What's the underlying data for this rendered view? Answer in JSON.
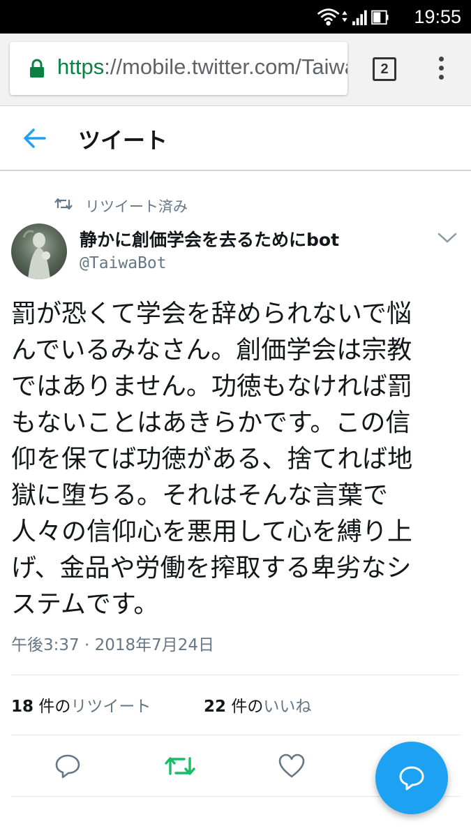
{
  "status_bar": {
    "time": "19:55"
  },
  "browser": {
    "url_scheme": "https",
    "url_rest": "://mobile.twitter.com/TaiwaBot",
    "tab_count": "2"
  },
  "header": {
    "title": "ツイート"
  },
  "tweet": {
    "retweeted_label": "リツイート済み",
    "author_name": "静かに創価学会を去るためにbot",
    "author_handle": "@TaiwaBot",
    "text_lines": [
      "罰が恐くて学会を辞められないで悩",
      "んでいるみなさん。創価学会は宗教",
      "ではありません。功徳もなければ罰",
      "もないことはあきらかです。この信",
      "仰を保てば功徳がある、捨てれば地",
      "獄に堕ちる。それはそんな言葉で",
      "人々の信仰心を悪用して心を縛り上",
      "げ、金品や労働を搾取する卑劣なシ",
      "ステムです。"
    ],
    "timestamp": "午後3:37 · 2018年7月24日",
    "retweet_count": "18",
    "retweet_unit": "件の",
    "retweet_label": "リツイート",
    "like_count": "22",
    "like_unit": "件の",
    "like_label": "いいね"
  },
  "colors": {
    "accent": "#1da1f2",
    "retweet_green": "#17bf63",
    "secure_green": "#0b8043",
    "muted": "#657786"
  }
}
